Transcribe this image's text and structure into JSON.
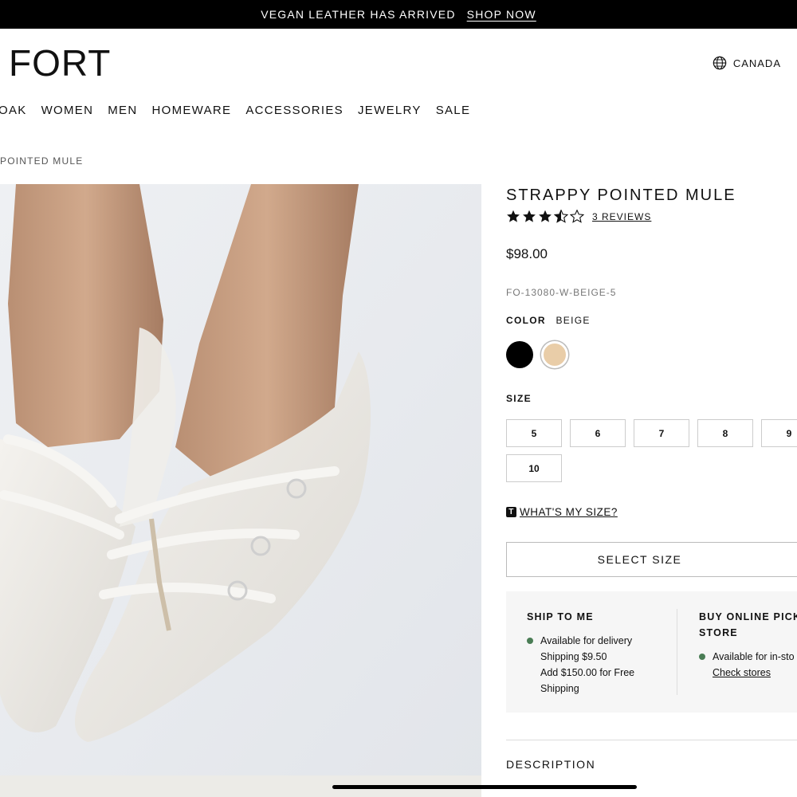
{
  "banner": {
    "message": "VEGAN LEATHER HAS ARRIVED",
    "link": "SHOP NOW"
  },
  "header": {
    "logo": "FORT",
    "region": "CANADA",
    "region_icon": "globe-icon"
  },
  "nav": [
    "OAK",
    "WOMEN",
    "MEN",
    "HOMEWARE",
    "ACCESSORIES",
    "JEWELRY",
    "SALE"
  ],
  "breadcrumb": "POINTED MULE",
  "product": {
    "title": "STRAPPY POINTED MULE",
    "rating": 3.5,
    "rating_max": 5,
    "reviews_label": "3 REVIEWS",
    "price": "$98.00",
    "sku": "FO-13080-W-BEIGE-5",
    "color_label": "COLOR",
    "color_value": "BEIGE",
    "colors": [
      {
        "name": "black",
        "hex": "#000000",
        "selected": false
      },
      {
        "name": "beige",
        "hex": "#e9cda8",
        "selected": true
      }
    ],
    "size_label": "SIZE",
    "sizes": [
      "5",
      "6",
      "7",
      "8",
      "9",
      "10"
    ],
    "size_guide": "WHAT'S MY SIZE?",
    "size_guide_icon": "t-badge-icon",
    "cta": "SELECT SIZE"
  },
  "shipping": {
    "ship_to_me": {
      "title": "SHIP TO ME",
      "lines": [
        "Available for delivery",
        "Shipping $9.50",
        "Add $150.00 for Free Shipping"
      ]
    },
    "pickup": {
      "title": "BUY ONLINE PICK U\nSTORE",
      "line": "Available for in-sto",
      "link": "Check stores"
    },
    "status_color": "#4a7d55"
  },
  "description": {
    "title": "DESCRIPTION"
  }
}
